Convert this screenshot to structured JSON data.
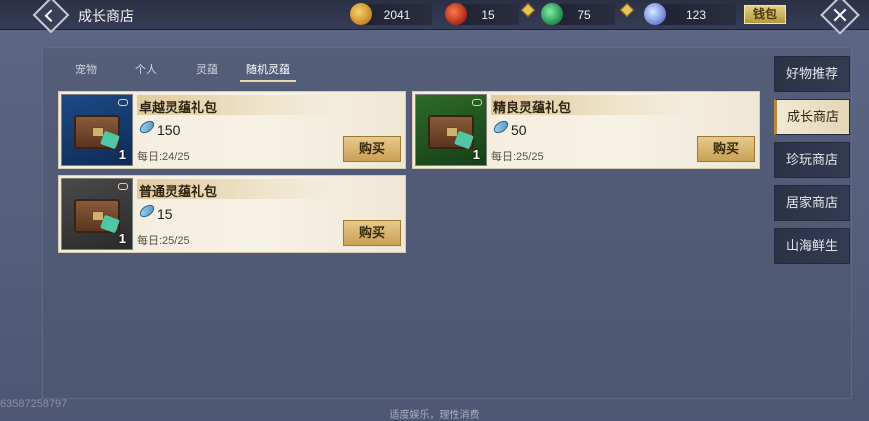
{
  "header": {
    "title": "成长商店"
  },
  "resources": [
    {
      "icon": "gold-coin-icon",
      "value": "2041"
    },
    {
      "icon": "red-token-icon",
      "value": "15"
    },
    {
      "icon": "jade-icon",
      "value": "75"
    },
    {
      "icon": "crystal-icon",
      "value": "123"
    }
  ],
  "wallet_label": "钱包",
  "tabs": [
    {
      "label": "宠物"
    },
    {
      "label": "个人"
    },
    {
      "label": "灵蕴"
    },
    {
      "label": "随机灵蕴"
    }
  ],
  "items": [
    {
      "name": "卓越灵蕴礼包",
      "price": "150",
      "daily": "每日:24/25",
      "qty": "1",
      "buy": "购买",
      "rarity_color": "#1c4b86"
    },
    {
      "name": "精良灵蕴礼包",
      "price": "50",
      "daily": "每日:25/25",
      "qty": "1",
      "buy": "购买",
      "rarity_color": "#2d6a2a"
    },
    {
      "name": "普通灵蕴礼包",
      "price": "15",
      "daily": "每日:25/25",
      "qty": "1",
      "buy": "购买",
      "rarity_color": "#4a4a4a"
    }
  ],
  "nav": [
    {
      "label": "好物推荐"
    },
    {
      "label": "成长商店"
    },
    {
      "label": "珍玩商店"
    },
    {
      "label": "居家商店"
    },
    {
      "label": "山海鲜生"
    }
  ],
  "footer_note": "适度娱乐，理性消费",
  "uid": "63587258797"
}
